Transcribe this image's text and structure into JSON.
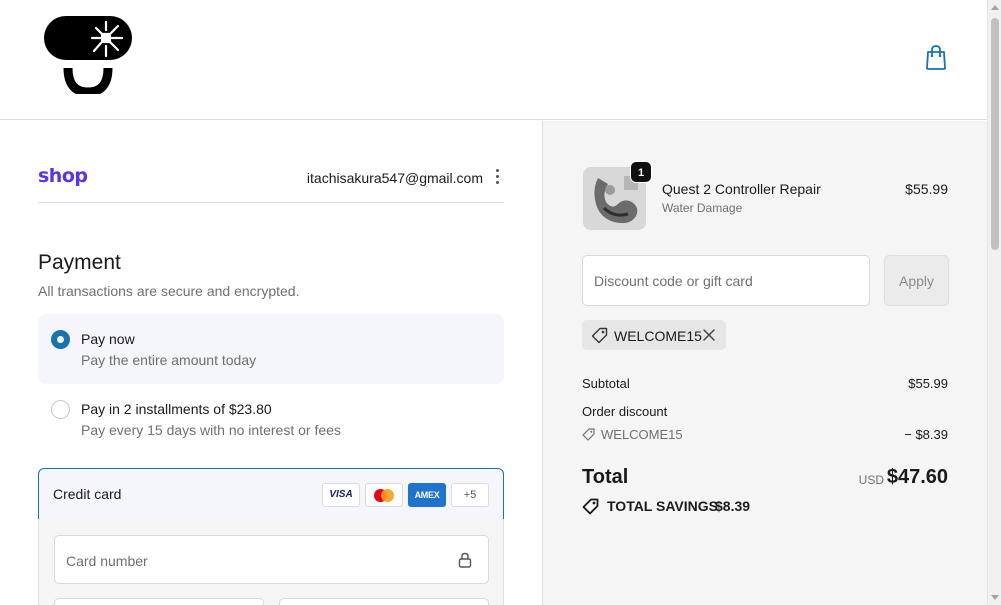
{
  "header": {
    "logo_icon": "brand-logo-icon",
    "cart_icon": "shopping-bag-icon"
  },
  "account": {
    "shop_logo": "shop",
    "email": "itachisakura547@gmail.com",
    "menu_icon": "kebab-menu-icon"
  },
  "payment": {
    "title": "Payment",
    "subtitle": "All transactions are secure and encrypted.",
    "options": [
      {
        "title": "Pay now",
        "description": "Pay the entire amount today",
        "selected": true
      },
      {
        "title": "Pay in 2 installments of $23.80",
        "description": "Pay every 15 days with no interest or fees",
        "selected": false
      }
    ],
    "credit_card": {
      "label": "Credit card",
      "brands": [
        "VISA",
        "Mastercard",
        "AMEX"
      ],
      "more_brands": "+5",
      "card_number_placeholder": "Card number"
    }
  },
  "order": {
    "product": {
      "name": "Quest 2 Controller Repair",
      "variant": "Water Damage",
      "price": "$55.99",
      "quantity": "1"
    },
    "discount": {
      "placeholder": "Discount code or gift card",
      "apply_label": "Apply",
      "applied_code": "WELCOME15"
    },
    "summary": {
      "subtotal_label": "Subtotal",
      "subtotal_value": "$55.99",
      "order_discount_label": "Order discount",
      "discount_code": "WELCOME15",
      "discount_value": "− $8.39",
      "total_label": "Total",
      "currency": "USD",
      "total_value": "$47.60",
      "savings_label": "TOTAL SAVINGS",
      "savings_value": "$8.39"
    }
  },
  "colors": {
    "accent": "#1773b0",
    "shop_brand": "#5a31f4"
  }
}
